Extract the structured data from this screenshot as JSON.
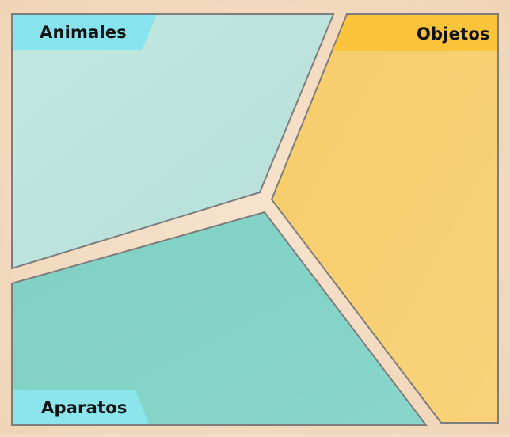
{
  "categories": [
    {
      "id": "animales",
      "label": "Animales"
    },
    {
      "id": "objetos",
      "label": "Objetos"
    },
    {
      "id": "aparatos",
      "label": "Aparatos"
    }
  ],
  "colors": {
    "background": "#f3dcc3",
    "animales_zone": "#bfe5df",
    "animales_tab": "#87e3ee",
    "objetos_zone": "#f8cf6e",
    "objetos_tab": "#fbc43a",
    "aparatos_zone": "#83d2c6",
    "aparatos_tab": "#8be5ea",
    "border": "#7d7d7d",
    "label_text": "#121212"
  }
}
